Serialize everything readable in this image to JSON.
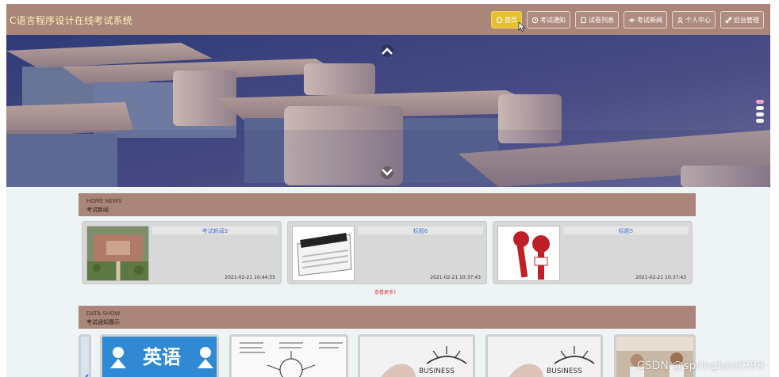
{
  "site": {
    "title": "C语言程序设计在线考试系统"
  },
  "nav": {
    "items": [
      {
        "label": "首页",
        "icon": "home-icon",
        "active": true
      },
      {
        "label": "考试通知",
        "icon": "clock-icon",
        "active": false
      },
      {
        "label": "试卷列表",
        "icon": "document-icon",
        "active": false
      },
      {
        "label": "考试新闻",
        "icon": "news-icon",
        "active": false
      },
      {
        "label": "个人中心",
        "icon": "user-icon",
        "active": false
      },
      {
        "label": "后台管理",
        "icon": "link-icon",
        "active": false
      }
    ]
  },
  "colors": {
    "header": "#a98679",
    "active_nav": "#e7bf33",
    "brand_text": "#fff3b6",
    "link": "#4a78d4",
    "more": "#d33333"
  },
  "hero": {
    "scene": "classroom-desks",
    "up_icon": "chevron-up-icon",
    "down_icon": "chevron-down-icon",
    "dot_count": 4
  },
  "news_section": {
    "en": "HOME NEWS",
    "cn": "考试新闻",
    "cards": [
      {
        "title": "考试新闻3",
        "date": "2021-02-21 10:44:55",
        "image": "campus-aerial"
      },
      {
        "title": "标题6",
        "date": "2021-02-21 10:37:43",
        "image": "news-newspaper"
      },
      {
        "title": "标题5",
        "date": "2021-02-21 10:37:43",
        "image": "news-microphone"
      }
    ],
    "more_label": "查看更多》"
  },
  "data_section": {
    "en": "DATA SHOW",
    "cn": "考试通知展示",
    "cards": [
      {
        "image": "partial-left"
      },
      {
        "image": "english-sign",
        "text": "英语"
      },
      {
        "image": "mind-map-notes"
      },
      {
        "image": "business-sketch",
        "text": "BUSINESS"
      },
      {
        "image": "business-sketch",
        "text": "BUSINESS"
      },
      {
        "image": "office-photo"
      }
    ]
  },
  "watermark": "CSDN @springboot999"
}
